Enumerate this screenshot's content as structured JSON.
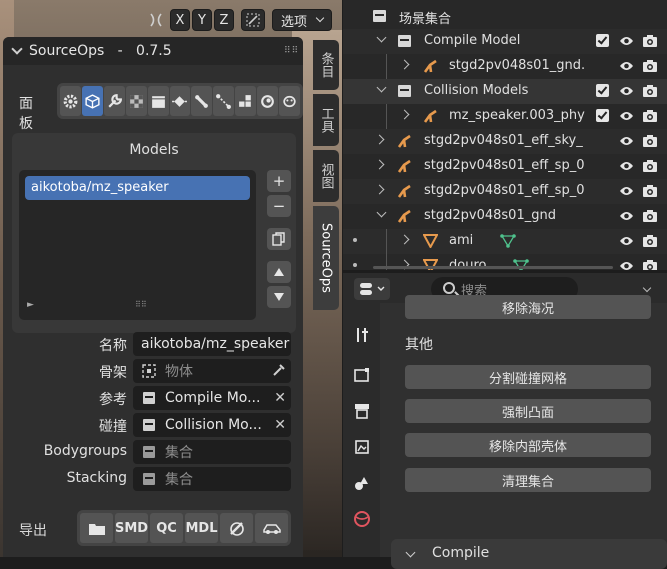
{
  "viewport_header": {
    "x": "X",
    "y": "Y",
    "z": "Z",
    "options_label": "选项"
  },
  "panel": {
    "title": "SourceOps   -   0.7.5",
    "tools_label": "面板",
    "models_title": "Models",
    "models": [
      "aikotoba/mz_speaker"
    ],
    "name_label": "名称",
    "name_value": "aikotoba/mz_speaker",
    "armature_label": "骨架",
    "armature_placeholder": "物体",
    "reference_label": "参考",
    "reference_value": "Compile Mo...",
    "collision_label": "碰撞",
    "collision_value": "Collision Mo...",
    "bodygroups_label": "Bodygroups",
    "bodygroups_placeholder": "集合",
    "stacking_label": "Stacking",
    "stacking_placeholder": "集合",
    "export_label": "导出",
    "export_buttons": [
      "SMD",
      "QC",
      "MDL"
    ]
  },
  "vertical_tabs": [
    "条目",
    "工具",
    "视图",
    "SourceOps"
  ],
  "outliner": {
    "rows": [
      {
        "label": "场景集合"
      },
      {
        "label": "Compile Model"
      },
      {
        "label": "stgd2pv048s01_gnd."
      },
      {
        "label": "Collision Models"
      },
      {
        "label": "mz_speaker.003_phy"
      },
      {
        "label": "stgd2pv048s01_eff_sky_"
      },
      {
        "label": "stgd2pv048s01_eff_sp_0"
      },
      {
        "label": "stgd2pv048s01_eff_sp_0"
      },
      {
        "label": "stgd2pv048s01_gnd"
      },
      {
        "label": "ami"
      },
      {
        "label": "douro"
      }
    ]
  },
  "properties": {
    "search_placeholder": "搜索",
    "top_button": "移除海况",
    "section_label": "其他",
    "buttons": [
      "分割碰撞网格",
      "强制凸面",
      "移除内部壳体",
      "清理集合"
    ],
    "compile_section": "Compile"
  }
}
